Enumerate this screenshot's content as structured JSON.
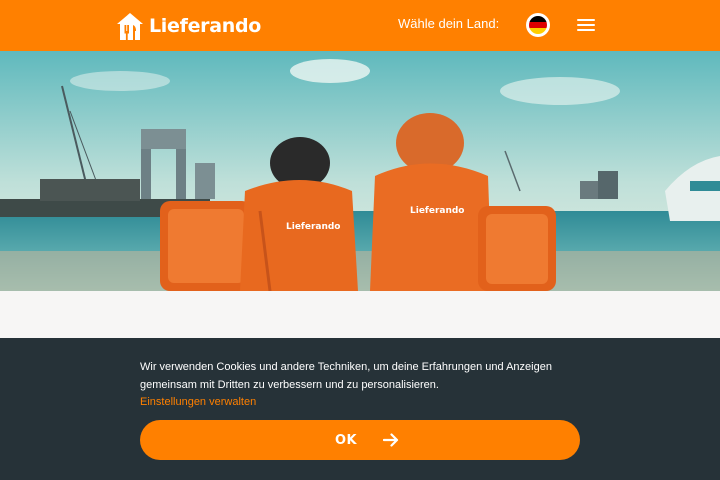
{
  "header": {
    "logo_text": "Lieferando",
    "country_label": "Wähle dein Land:",
    "flag_icon": "germany-flag-icon",
    "menu_icon": "hamburger-menu-icon",
    "brand_color": "#ff8000"
  },
  "hero": {
    "image": "two couriers in orange Lieferando jackets sitting by a harbour"
  },
  "cookie_banner": {
    "text": "Wir verwenden Cookies und andere Techniken, um deine Erfahrungen und Anzeigen gemeinsam mit Dritten zu verbessern und zu personalisieren.",
    "settings_link": "Einstellungen verwalten",
    "ok_label": "OK",
    "ok_icon": "arrow-right-icon",
    "background_color": "#263238",
    "accent_color": "#ff8000"
  }
}
